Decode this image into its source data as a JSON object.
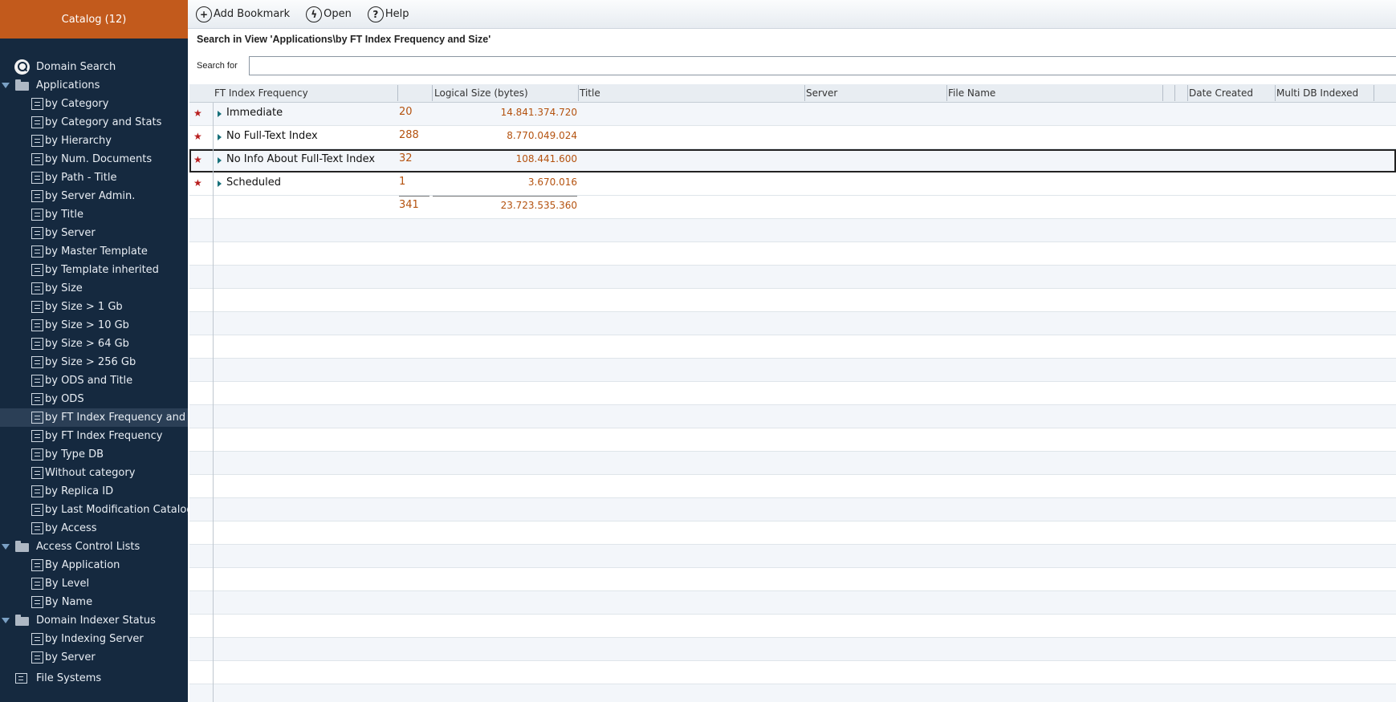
{
  "sidebar": {
    "header": "Catalog (12)",
    "items": [
      {
        "label": "Domain Search",
        "type": "search"
      },
      {
        "label": "Applications",
        "type": "folder"
      },
      {
        "label": "by Category",
        "type": "view"
      },
      {
        "label": "by Category and Stats",
        "type": "view"
      },
      {
        "label": "by Hierarchy",
        "type": "view"
      },
      {
        "label": "by Num. Documents",
        "type": "view"
      },
      {
        "label": "by Path - Title",
        "type": "view"
      },
      {
        "label": "by Server Admin.",
        "type": "view"
      },
      {
        "label": "by Title",
        "type": "view"
      },
      {
        "label": "by Server",
        "type": "view"
      },
      {
        "label": "by Master Template",
        "type": "view"
      },
      {
        "label": "by Template inherited",
        "type": "view"
      },
      {
        "label": "by Size",
        "type": "view"
      },
      {
        "label": "by Size > 1 Gb",
        "type": "view"
      },
      {
        "label": "by Size > 10 Gb",
        "type": "view"
      },
      {
        "label": "by Size > 64 Gb",
        "type": "view"
      },
      {
        "label": "by Size > 256 Gb",
        "type": "view"
      },
      {
        "label": "by ODS and Title",
        "type": "view"
      },
      {
        "label": "by ODS",
        "type": "view"
      },
      {
        "label": "by FT Index Frequency and Siz",
        "type": "view",
        "selected": true
      },
      {
        "label": "by FT Index Frequency",
        "type": "view"
      },
      {
        "label": "by Type DB",
        "type": "view"
      },
      {
        "label": "Without category",
        "type": "view"
      },
      {
        "label": "by Replica ID",
        "type": "view"
      },
      {
        "label": "by Last Modification Catalog",
        "type": "view"
      },
      {
        "label": "by Access",
        "type": "view"
      },
      {
        "label": "Access Control Lists",
        "type": "folder"
      },
      {
        "label": "By Application",
        "type": "view"
      },
      {
        "label": "By Level",
        "type": "view"
      },
      {
        "label": "By Name",
        "type": "view"
      },
      {
        "label": "Domain Indexer Status",
        "type": "folder"
      },
      {
        "label": "by Indexing Server",
        "type": "view"
      },
      {
        "label": "by Server",
        "type": "view"
      },
      {
        "label": "File Systems",
        "type": "filesystem"
      }
    ]
  },
  "toolbar": {
    "add_bookmark": "Add Bookmark",
    "open": "Open",
    "help": "Help"
  },
  "search": {
    "title": "Search in View 'Applications\\by FT Index Frequency and Size'",
    "label": "Search for",
    "value": "",
    "placeholder": ""
  },
  "grid": {
    "columns": [
      "FT Index Frequency",
      "",
      "Logical Size (bytes)",
      "Title",
      "Server",
      "File Name",
      "",
      "Date Created",
      "Multi DB Indexed"
    ],
    "rows": [
      {
        "name": "Immediate",
        "count": "20",
        "size": "14.841.374.720"
      },
      {
        "name": "No Full-Text Index",
        "count": "288",
        "size": "8.770.049.024"
      },
      {
        "name": "No Info About Full-Text Index",
        "count": "32",
        "size": "108.441.600",
        "selected": true
      },
      {
        "name": "Scheduled",
        "count": "1",
        "size": "3.670.016"
      }
    ],
    "total": {
      "count": "341",
      "size": "23.723.535.360"
    }
  },
  "colors": {
    "sidebar_bg": "#15293f",
    "header_accent": "#c25a1c",
    "value_text": "#b4520f",
    "star": "#b81e1e"
  }
}
